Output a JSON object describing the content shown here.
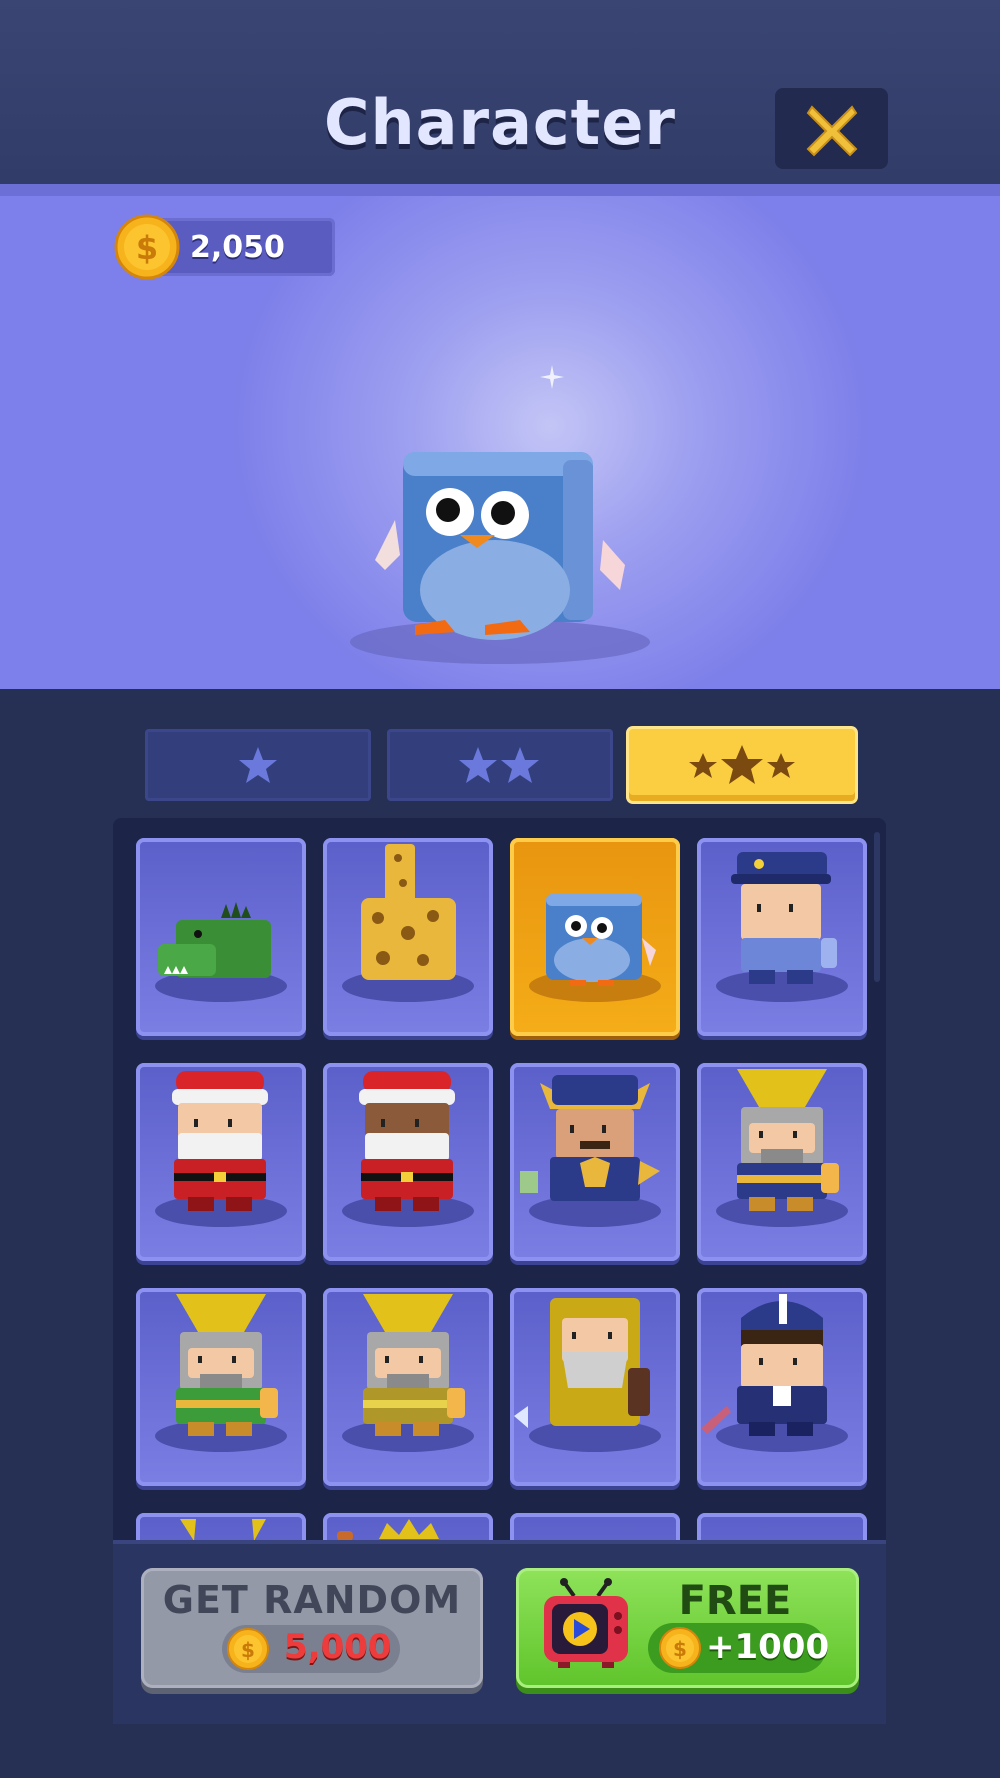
{
  "header": {
    "title": "Character"
  },
  "wallet": {
    "coins": "2,050"
  },
  "tabs": [
    {
      "stars": 1,
      "selected": false
    },
    {
      "stars": 2,
      "selected": false
    },
    {
      "stars": 3,
      "selected": true
    }
  ],
  "grid": {
    "items": [
      {
        "icon": "crocodile-character-icon",
        "selected": false
      },
      {
        "icon": "giraffe-character-icon",
        "selected": false
      },
      {
        "icon": "penguin-character-icon",
        "selected": true
      },
      {
        "icon": "police-officer-character-icon",
        "selected": false
      },
      {
        "icon": "santa-character-icon",
        "selected": false
      },
      {
        "icon": "santa-dark-skin-character-icon",
        "selected": false
      },
      {
        "icon": "samurai-character-icon",
        "selected": false
      },
      {
        "icon": "king-blue-character-icon",
        "selected": false
      },
      {
        "icon": "king-green-character-icon",
        "selected": false
      },
      {
        "icon": "king-gold-character-icon",
        "selected": false
      },
      {
        "icon": "wizard-character-icon",
        "selected": false
      },
      {
        "icon": "admiral-character-icon",
        "selected": false
      }
    ]
  },
  "actions": {
    "random_label": "GET RANDOM",
    "random_price": "5,000",
    "free_label": "FREE",
    "free_reward": "+1000"
  },
  "colors": {
    "accent_gold": "#fbcd40",
    "selected_card": "#f5ad18",
    "free_green": "#5fc42b",
    "price_red": "#ee3b3b"
  }
}
